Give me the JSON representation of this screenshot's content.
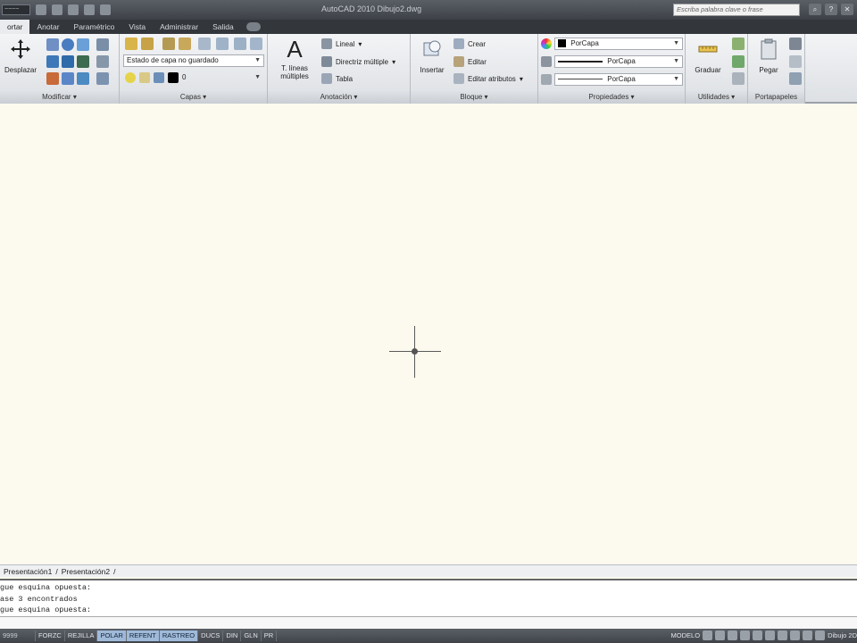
{
  "titlebar": {
    "app_title": "AutoCAD 2010   Dibujo2.dwg",
    "search_placeholder": "Escriba palabra clave o frase",
    "quick_field": "~~~~"
  },
  "menu_tabs": [
    "ortar",
    "Anotar",
    "Paramétrico",
    "Vista",
    "Administrar",
    "Salida"
  ],
  "ribbon": {
    "modify": {
      "label": "Modificar ▾",
      "move_label": "Desplazar"
    },
    "layers": {
      "label": "Capas ▾",
      "layer_state": "Estado de capa no guardado",
      "current_layer": "0"
    },
    "annotation": {
      "label": "Anotación ▾",
      "mtext_label_1": "T. líneas",
      "mtext_label_2": "múltiples",
      "linear_label": "Lineal",
      "mleader_label": "Directriz múltiple",
      "table_label": "Tabla"
    },
    "block": {
      "label": "Bloque ▾",
      "insert_label": "Insertar",
      "create_label": "Crear",
      "edit_label": "Editar",
      "edit_attr_label": "Editar atributos"
    },
    "properties": {
      "label": "Propiedades ▾",
      "color_value": "PorCapa",
      "lineweight_value": "PorCapa",
      "linetype_value": "PorCapa"
    },
    "utilities": {
      "label": "Utilidades ▾",
      "measure_label": "Graduar"
    },
    "clipboard": {
      "label": "Portapapeles",
      "paste_label": "Pegar"
    }
  },
  "layout_tabs": {
    "tab1": "Presentación1",
    "tab2": "Presentación2"
  },
  "command_history": [
    "gue esquina opuesta:",
    "ase 3 encontrados",
    "gue esquina opuesta:"
  ],
  "statusbar": {
    "coords": "9999",
    "toggles": [
      {
        "label": "FORZC",
        "on": false
      },
      {
        "label": "REJILLA",
        "on": false
      },
      {
        "label": "POLAR",
        "on": true
      },
      {
        "label": "REFENT",
        "on": true
      },
      {
        "label": "RASTREO",
        "on": true
      },
      {
        "label": "DUCS",
        "on": false
      },
      {
        "label": "DIN",
        "on": false
      },
      {
        "label": "GLN",
        "on": false
      },
      {
        "label": "PR",
        "on": false
      }
    ],
    "model_label": "MODELO",
    "workspace_label": "Dibujo 2D"
  }
}
